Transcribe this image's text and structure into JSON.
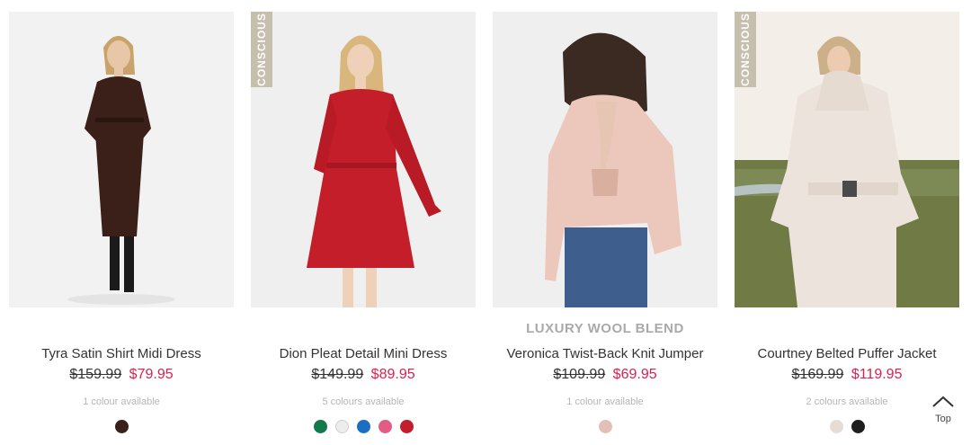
{
  "products": [
    {
      "name": "Tyra Satin Shirt Midi Dress",
      "was_price": "$159.99",
      "now_price": "$79.95",
      "colours_text": "1 colour available",
      "badge": "",
      "tag": "",
      "swatches": [
        "#3a1f1a"
      ]
    },
    {
      "name": "Dion Pleat Detail Mini Dress",
      "was_price": "$149.99",
      "now_price": "$89.95",
      "colours_text": "5 colours available",
      "badge": "CONSCIOUS",
      "tag": "",
      "swatches": [
        "#127a4a",
        "#ececea",
        "#1b6ec2",
        "#e45c86",
        "#c41e2c"
      ]
    },
    {
      "name": "Veronica Twist-Back Knit Jumper",
      "was_price": "$109.99",
      "now_price": "$69.95",
      "colours_text": "1 colour available",
      "badge": "",
      "tag": "LUXURY WOOL BLEND",
      "swatches": [
        "#e3c0b6"
      ]
    },
    {
      "name": "Courtney Belted Puffer Jacket",
      "was_price": "$169.99",
      "now_price": "$119.95",
      "colours_text": "2 colours available",
      "badge": "CONSCIOUS",
      "tag": "",
      "swatches": [
        "#e7dcd4",
        "#1e1e1e"
      ]
    }
  ],
  "back_to_top": {
    "label": "Top",
    "icon": "chevron-up-icon"
  }
}
